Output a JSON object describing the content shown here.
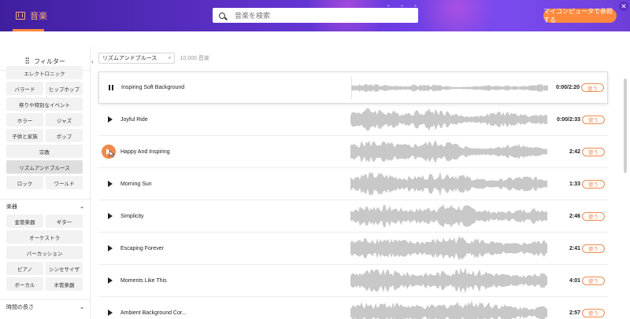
{
  "header": {
    "brand_label": "音楽",
    "search_placeholder": "音楽を検索",
    "cta_label": "マイコンピュータで参照する",
    "close_label": "✕",
    "colors": {
      "accent": "#ff8a3d",
      "header_start": "#3f1f9e",
      "header_end": "#7a4bef"
    }
  },
  "sidebar": {
    "filter_label": "フィルター",
    "genre_tags": [
      {
        "label": "エレクトロニック",
        "full": true
      },
      {
        "label": "バラード"
      },
      {
        "label": "ヒップホップ"
      },
      {
        "label": "祭りや特別なイベント",
        "full": true
      },
      {
        "label": "ホラー"
      },
      {
        "label": "ジャズ"
      },
      {
        "label": "子供と家族"
      },
      {
        "label": "ポップ"
      },
      {
        "label": "宗教",
        "full": true
      },
      {
        "label": "リズムアンドブルース",
        "full": true,
        "active": true
      },
      {
        "label": "ロック"
      },
      {
        "label": "ワールド"
      }
    ],
    "instrument_section": "楽器",
    "instrument_tags": [
      {
        "label": "金管楽器"
      },
      {
        "label": "ギター"
      },
      {
        "label": "オーケストラ",
        "full": true
      },
      {
        "label": "パーカッション",
        "full": true
      },
      {
        "label": "ピアノ"
      },
      {
        "label": "シンセサイザ"
      },
      {
        "label": "ボーカル"
      },
      {
        "label": "木管楽器"
      }
    ],
    "duration_section": "時間の長さ"
  },
  "toolbar": {
    "chip_label": "リズムアンドブルース",
    "chip_close": "×",
    "count": "10,000",
    "count_unit": "音楽"
  },
  "tracks": [
    {
      "title": "Inspiring Soft Background",
      "duration": "0:00/2:20",
      "state": "playing",
      "use": "使う"
    },
    {
      "title": "Joyful Ride",
      "duration": "0:00/2:33",
      "state": "paused",
      "use": "使う"
    },
    {
      "title": "Happy And Inspiring",
      "duration": "2:42",
      "state": "hover",
      "use": "使う"
    },
    {
      "title": "Morning Sun",
      "duration": "1:33",
      "state": "idle",
      "use": "使う"
    },
    {
      "title": "Simplicity",
      "duration": "2:46",
      "state": "idle",
      "use": "使う"
    },
    {
      "title": "Escaping Forever",
      "duration": "2:41",
      "state": "idle",
      "use": "使う"
    },
    {
      "title": "Moments Like This",
      "duration": "4:01",
      "state": "idle",
      "use": "使う"
    },
    {
      "title": "Ambient Background Cor...",
      "duration": "2:57",
      "state": "idle",
      "use": "使う"
    }
  ]
}
